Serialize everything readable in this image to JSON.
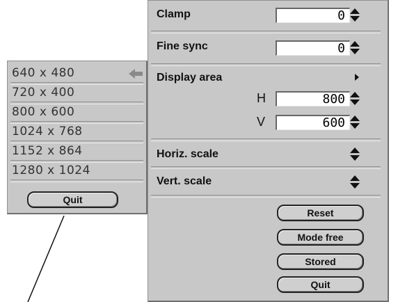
{
  "main_menu": {
    "clamp": {
      "label": "Clamp",
      "value": "0"
    },
    "fine_sync": {
      "label": "Fine sync",
      "value": "0"
    },
    "display_area": {
      "label": "Display area"
    },
    "h": {
      "label": "H",
      "value": "800"
    },
    "v": {
      "label": "V",
      "value": "600"
    },
    "horiz_scale": {
      "label": "Horiz. scale"
    },
    "vert_scale": {
      "label": "Vert. scale"
    },
    "buttons": {
      "reset": "Reset",
      "mode_free": "Mode free",
      "stored": "Stored",
      "quit": "Quit"
    }
  },
  "resolution_menu": {
    "items": [
      "640 x 480",
      "720 x 400",
      "800 x 600",
      "1024 x 768",
      "1152 x 864",
      "1280 x 1024"
    ],
    "selected": "640 x 480",
    "quit": "Quit"
  }
}
